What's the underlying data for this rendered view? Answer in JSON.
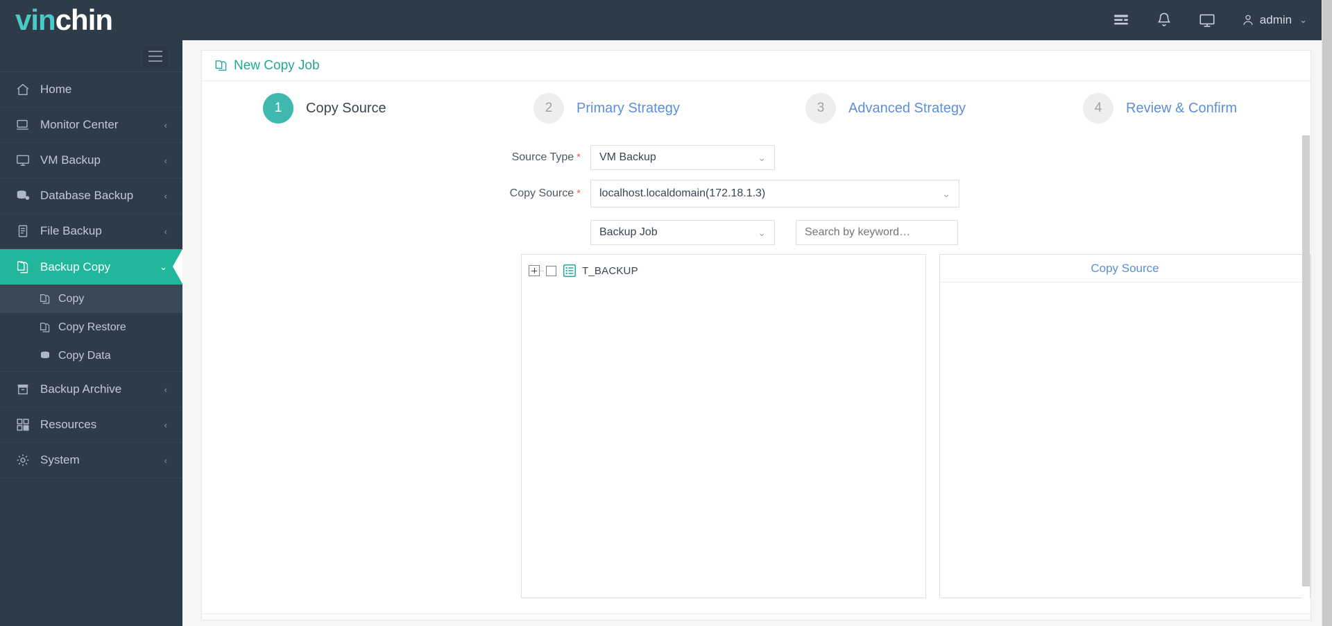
{
  "brand": {
    "part1": "vin",
    "part2": "chin",
    "accent": "#4cc8c6"
  },
  "header": {
    "icons": [
      {
        "name": "tasks-icon",
        "label": "Tasks"
      },
      {
        "name": "bell-icon",
        "label": "Notifications"
      },
      {
        "name": "monitor-icon",
        "label": "Console"
      }
    ],
    "user": {
      "name": "admin",
      "caret": "⌄",
      "icon": "user-icon"
    }
  },
  "sidebar": {
    "toggle": {
      "name": "menu-toggle",
      "icon": "hamburger-icon"
    },
    "items": [
      {
        "label": "Home",
        "icon": "home-icon",
        "caret": "",
        "active": false
      },
      {
        "label": "Monitor Center",
        "icon": "monitor-icon",
        "caret": "‹",
        "active": false
      },
      {
        "label": "VM Backup",
        "icon": "display-icon",
        "caret": "‹",
        "active": false
      },
      {
        "label": "Database Backup",
        "icon": "database-icon",
        "caret": "‹",
        "active": false
      },
      {
        "label": "File Backup",
        "icon": "file-icon",
        "caret": "‹",
        "active": false
      },
      {
        "label": "Backup Copy",
        "icon": "copy-icon",
        "caret": "⌄",
        "active": true
      }
    ],
    "sub_items": [
      {
        "label": "Copy",
        "icon": "copy-page-icon",
        "selected": true
      },
      {
        "label": "Copy Restore",
        "icon": "copy-restore-icon",
        "selected": false
      },
      {
        "label": "Copy Data",
        "icon": "copy-data-icon",
        "selected": false
      }
    ],
    "items_after": [
      {
        "label": "Backup Archive",
        "icon": "archive-icon",
        "caret": "‹",
        "active": false
      },
      {
        "label": "Resources",
        "icon": "grid-icon",
        "caret": "‹",
        "active": false
      },
      {
        "label": "System",
        "icon": "gear-icon",
        "caret": "‹",
        "active": false
      }
    ]
  },
  "page": {
    "title": "New Copy Job",
    "title_icon": "new-copy-job-icon",
    "title_color": "#23a793"
  },
  "stepper": {
    "steps": [
      {
        "num": "1",
        "label": "Copy Source",
        "state": "current"
      },
      {
        "num": "2",
        "label": "Primary Strategy",
        "state": "todo"
      },
      {
        "num": "3",
        "label": "Advanced Strategy",
        "state": "todo"
      },
      {
        "num": "4",
        "label": "Review & Confirm",
        "state": "todo"
      }
    ],
    "current_color": "#3fb8ae",
    "todo_color": "#eeeeee",
    "todo_text_color": "#5b8fd8"
  },
  "form": {
    "source_type": {
      "label": "Source Type",
      "required": "*",
      "value": "VM Backup",
      "caret": "⌄"
    },
    "copy_source": {
      "label": "Copy Source",
      "required": "*",
      "value": "localhost.localdomain(172.18.1.3)",
      "caret": "⌄"
    },
    "job_type": {
      "value": "Backup Job",
      "caret": "⌄"
    },
    "search": {
      "placeholder": "Search by keyword…",
      "value": ""
    },
    "tree": {
      "nodes": [
        {
          "label": "T_BACKUP",
          "expand": "+",
          "checked": false,
          "icon": "backup-job-list-icon"
        }
      ]
    },
    "selection_panel": {
      "title": "Copy Source",
      "title_color": "#5b8fd8",
      "items": []
    }
  }
}
